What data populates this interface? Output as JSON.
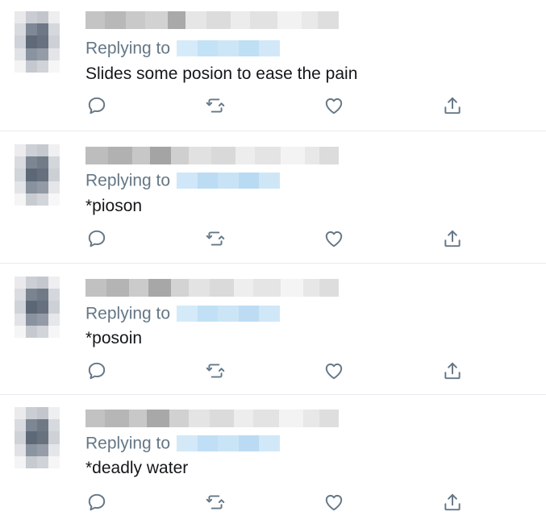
{
  "tweets": [
    {
      "reply_label": "Replying to",
      "text": "Slides some posion to ease the pain"
    },
    {
      "reply_label": "Replying to",
      "text": "*pioson"
    },
    {
      "reply_label": "Replying to",
      "text": "*posoin"
    },
    {
      "reply_label": "Replying to",
      "text": "*deadly water"
    }
  ],
  "icons": [
    "reply-icon",
    "retweet-icon",
    "like-icon",
    "share-icon"
  ],
  "colors": {
    "secondary_text": "#657786",
    "primary_text": "#14171a",
    "divider": "#e6ecf0",
    "handle_blur": "#cde6f7"
  }
}
